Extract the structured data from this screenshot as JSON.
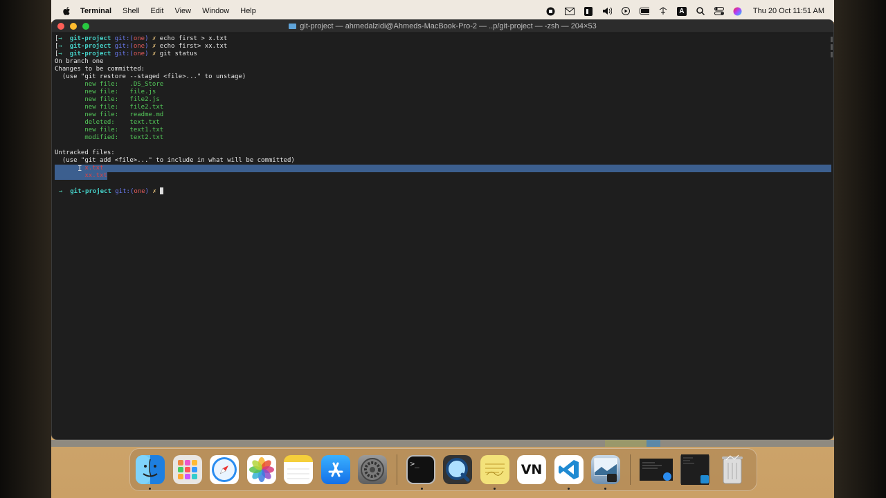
{
  "menubar": {
    "app_name": "Terminal",
    "items": [
      "Shell",
      "Edit",
      "View",
      "Window",
      "Help"
    ],
    "clock": "Thu 20 Oct  11:51 AM",
    "status_icons": [
      "screen-record-icon",
      "gmail-icon",
      "office-icon",
      "volume-icon",
      "play-icon",
      "battery-icon",
      "network-icon",
      "input-source-icon",
      "search-icon",
      "control-center-icon",
      "siri-icon"
    ],
    "input_source_label": "A"
  },
  "window": {
    "title": "git-project — ahmedalzidi@Ahmeds-MacBook-Pro-2 — ..p/git-project — -zsh — 204×53"
  },
  "terminal": {
    "prompt_arrow": "→",
    "prompt_bracket": "[",
    "dir": "git-project",
    "git_label": "git:",
    "branch_open": "(",
    "branch": "one",
    "branch_close": ")",
    "dirty": "✗",
    "cmd1": "echo first > x.txt",
    "cmd2": "echo first> xx.txt",
    "cmd3": "git status",
    "out_branch": "On branch one",
    "out_changes": "Changes to be committed:",
    "out_restore_hint": "  (use \"git restore --staged <file>...\" to unstage)",
    "staged": [
      {
        "status": "new file:",
        "file": ".DS_Store"
      },
      {
        "status": "new file:",
        "file": "file.js"
      },
      {
        "status": "new file:",
        "file": "file2.js"
      },
      {
        "status": "new file:",
        "file": "file2.txt"
      },
      {
        "status": "new file:",
        "file": "readme.md"
      },
      {
        "status": "deleted:",
        "file": "text.txt"
      },
      {
        "status": "new file:",
        "file": "text1.txt"
      },
      {
        "status": "modified:",
        "file": "text2.txt"
      }
    ],
    "out_untracked": "Untracked files:",
    "out_add_hint": "  (use \"git add <file>...\" to include in what will be committed)",
    "untracked": [
      "x.txt",
      "xx.txt"
    ]
  },
  "dock": {
    "apps": [
      {
        "name": "Finder"
      },
      {
        "name": "Launchpad"
      },
      {
        "name": "Safari"
      },
      {
        "name": "Photos"
      },
      {
        "name": "Notes"
      },
      {
        "name": "App Store"
      },
      {
        "name": "System Preferences"
      },
      {
        "name": "Terminal",
        "glyph": ">_"
      },
      {
        "name": "QuickTime Player"
      },
      {
        "name": "Stickies"
      },
      {
        "name": "VN",
        "glyph": "VN"
      },
      {
        "name": "Visual Studio Code"
      },
      {
        "name": "Preview"
      }
    ]
  }
}
